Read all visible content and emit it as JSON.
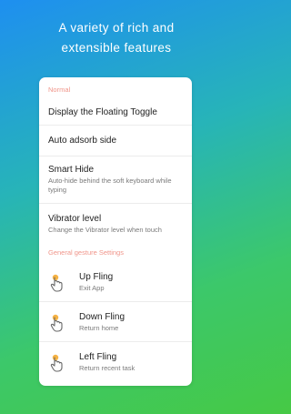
{
  "headline": {
    "line1": "A variety of rich and",
    "line2": "extensible features"
  },
  "sections": {
    "normal_label": "Normal",
    "gesture_label": "General gesture Settings"
  },
  "normal_items": [
    {
      "title": "Display the Floating Toggle"
    },
    {
      "title": "Auto adsorb side"
    },
    {
      "title": "Smart Hide",
      "desc": "Auto-hide behind the soft keyboard while typing"
    },
    {
      "title": "Vibrator level",
      "desc": "Change the Vibrator level when touch"
    }
  ],
  "gesture_items": [
    {
      "title": "Up Fling",
      "desc": "Exit App",
      "icon": "hand-pointer-icon"
    },
    {
      "title": "Down Fling",
      "desc": "Return home",
      "icon": "hand-pointer-icon"
    },
    {
      "title": "Left Fling",
      "desc": "Return recent task",
      "icon": "hand-pointer-icon"
    }
  ],
  "colors": {
    "section_label": "#f0958a",
    "gesture_icon_accent": "#f5a623",
    "background_top": "#1e8ff0",
    "background_bottom": "#46c945"
  }
}
